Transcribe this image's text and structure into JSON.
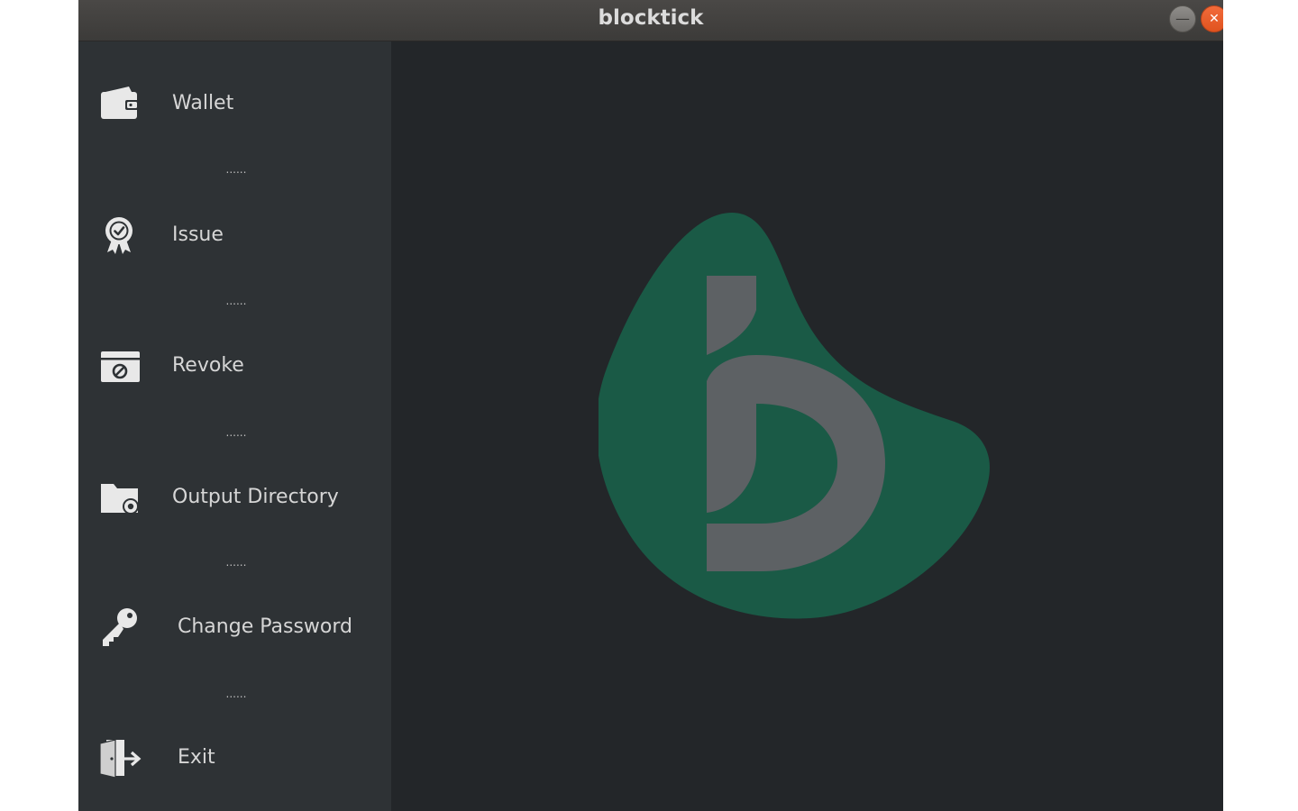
{
  "window": {
    "title": "blocktick",
    "minimize_glyph": "—",
    "close_glyph": "✕"
  },
  "sidebar": {
    "items": [
      {
        "label": "Wallet",
        "icon": "wallet-icon"
      },
      {
        "label": "Issue",
        "icon": "certificate-badge-icon"
      },
      {
        "label": "Revoke",
        "icon": "revoke-icon"
      },
      {
        "label": "Output Directory",
        "icon": "folder-icon"
      },
      {
        "label": "Change Password",
        "icon": "key-icon"
      },
      {
        "label": "Exit",
        "icon": "exit-icon"
      }
    ],
    "separator": "......"
  },
  "logo": {
    "icon": "blocktick-logo",
    "blob_color": "#1a5a46",
    "letter_color": "#5d6164"
  },
  "colors": {
    "sidebar_bg": "#2e3235",
    "main_bg": "#232629",
    "text": "#d6d6d6"
  }
}
